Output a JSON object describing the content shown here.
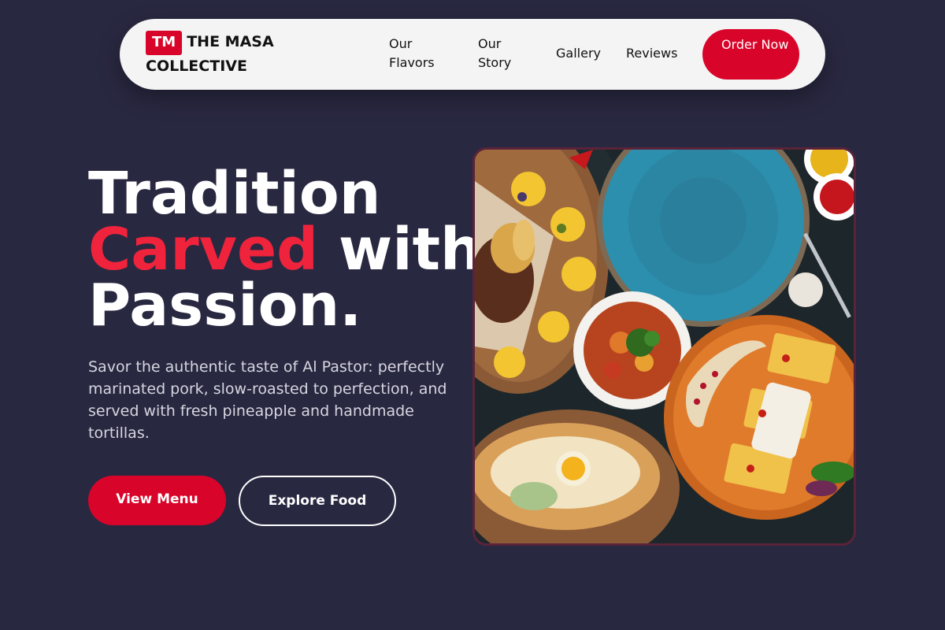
{
  "brand": {
    "badge": "TM",
    "name": "THE MASA COLLECTIVE",
    "badge_color": "#d90429"
  },
  "nav": {
    "items": [
      {
        "label": "Our Flavors"
      },
      {
        "label": "Our Story"
      },
      {
        "label": "Gallery"
      },
      {
        "label": "Reviews"
      }
    ],
    "cta_label": "Order Now"
  },
  "hero": {
    "title_line1": "Tradition",
    "title_accent": "Carved",
    "title_rest": " with",
    "title_line3": "Passion.",
    "description": "Savor the authentic taste of Al Pastor: perfectly marinated pork, slow-roasted to perfection, and served with fresh pineapple and handmade tortillas.",
    "primary_button": "View Menu",
    "secondary_button": "Explore Food",
    "image_icon": "food-spread-photo"
  },
  "colors": {
    "background": "#292841",
    "accent": "#ef233c",
    "button": "#d90429",
    "nav_background": "#f4f4f4"
  }
}
